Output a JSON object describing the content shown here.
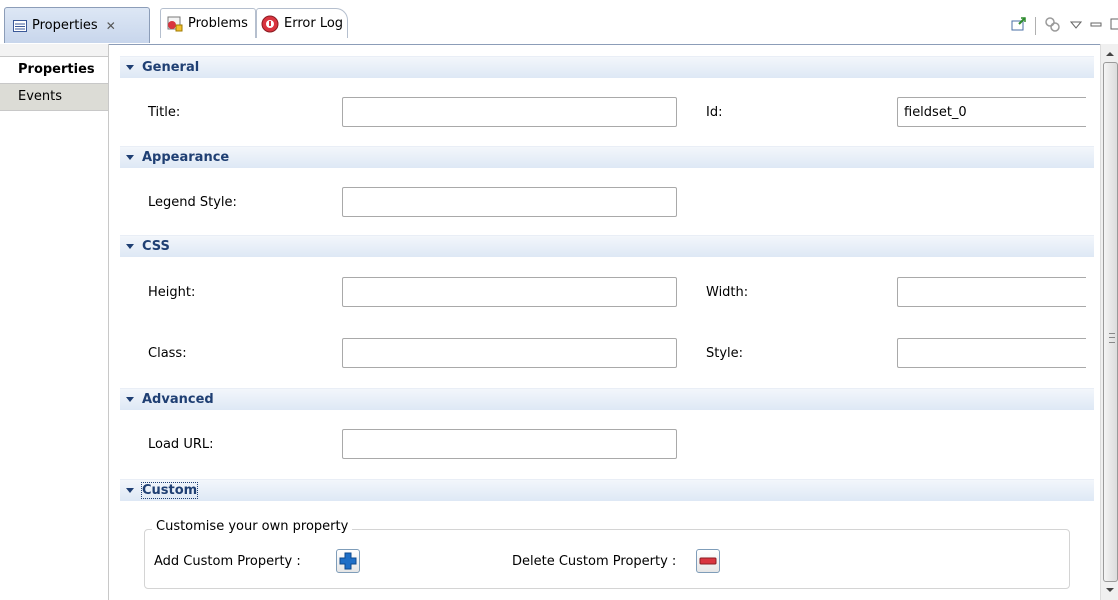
{
  "tabs": [
    {
      "label": "Properties",
      "close": "✕"
    },
    {
      "label": "Problems"
    },
    {
      "label": "Error Log"
    }
  ],
  "side_tabs": [
    "Properties",
    "Events"
  ],
  "sections": {
    "general": "General",
    "appearance": "Appearance",
    "css": "CSS",
    "advanced": "Advanced",
    "custom": "Custom"
  },
  "fields": {
    "title_label": "Title:",
    "title_value": "",
    "id_label": "Id:",
    "id_value": "fieldset_0",
    "legend_style_label": "Legend Style:",
    "legend_style_value": "",
    "height_label": "Height:",
    "height_value": "",
    "width_label": "Width:",
    "width_value": "",
    "class_label": "Class:",
    "class_value": "",
    "style_label": "Style:",
    "style_value": "",
    "load_url_label": "Load URL:",
    "load_url_value": ""
  },
  "custom": {
    "group_title": "Customise your own property",
    "add_label": "Add Custom Property :",
    "delete_label": "Delete Custom Property :"
  },
  "colors": {
    "section_text": "#1f3f73",
    "add_button": "#1f6fc7",
    "delete_button": "#d9343f"
  },
  "icons": [
    "properties-icon",
    "problems-icon",
    "error-log-icon",
    "pin-icon",
    "link-icon",
    "view-menu-icon",
    "minimize-icon",
    "maximize-icon"
  ]
}
